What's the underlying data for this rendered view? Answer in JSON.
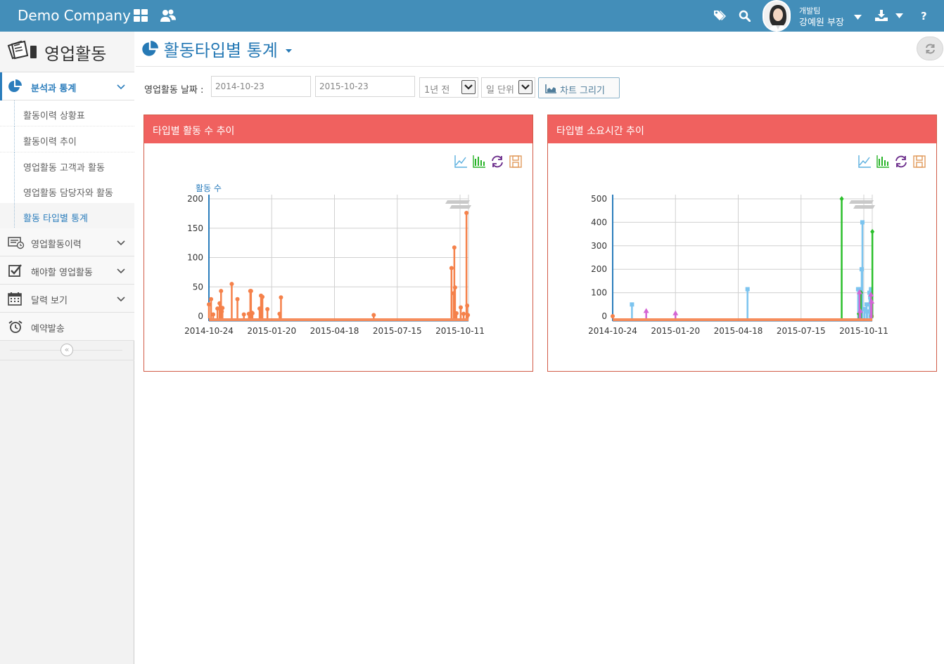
{
  "app": {
    "brand": "Demo Company",
    "user_dept": "개발팀",
    "user_name": "강예원 부장"
  },
  "sidebar": {
    "title": "영업활동",
    "menu": [
      {
        "label": "분석과 통계",
        "icon": "pie-chart-icon"
      },
      {
        "label": "영업활동이력",
        "icon": "history-list-icon"
      },
      {
        "label": "해야할 영업활동",
        "icon": "checkbox-icon"
      },
      {
        "label": "달력 보기",
        "icon": "calendar-icon"
      },
      {
        "label": "예약발송",
        "icon": "alarm-clock-icon"
      }
    ],
    "submenu": [
      {
        "label": "활동이력 상황표"
      },
      {
        "label": "활동이력 추이"
      },
      {
        "label": "영업활동 고객과 활동"
      },
      {
        "label": "영업활동 담당자와 활동"
      },
      {
        "label": "활동 타입별 통계"
      }
    ]
  },
  "page": {
    "title": "활동타입별 통계"
  },
  "filter": {
    "label": "영업활동 날짜 :",
    "start_date": "2014-10-23",
    "end_date": "2015-10-23",
    "period_selected": "1년 전",
    "unit_selected": "일 단위",
    "draw_button": "차트 그리기"
  },
  "colors": {
    "header": "#438eb9",
    "panel_header": "#f0615f",
    "accent": "#2679b5",
    "orange": "#f5814a",
    "blue": "#7cc4ef",
    "green": "#2bbf2b",
    "pink": "#d465d4"
  },
  "chart_data": [
    {
      "type": "line",
      "title": "타입별 활동 수 추이",
      "ylabel": "활동 수",
      "x_ticks": [
        "2014-10-24",
        "2015-01-20",
        "2015-04-18",
        "2015-07-15",
        "2015-10-11"
      ],
      "y_ticks": [
        0,
        50,
        100,
        150,
        200
      ],
      "ylim": [
        0,
        200
      ],
      "grid": true,
      "series": [
        {
          "color": "#f5814a",
          "x": [
            "2014-10-24",
            "2014-10-27",
            "2014-10-30",
            "2014-11-05",
            "2014-11-08",
            "2014-11-10",
            "2014-11-11",
            "2014-11-12",
            "2014-11-25",
            "2014-12-03",
            "2014-12-12",
            "2014-12-19",
            "2014-12-21",
            "2014-12-22",
            "2014-12-23",
            "2014-12-24",
            "2015-01-03",
            "2015-01-05",
            "2015-01-07",
            "2015-01-14",
            "2015-01-31",
            "2015-02-02",
            "2015-06-12",
            "2015-09-29",
            "2015-10-02",
            "2015-10-03",
            "2015-10-04",
            "2015-10-06",
            "2015-10-12",
            "2015-10-16",
            "2015-10-20",
            "2015-10-21",
            "2015-10-22"
          ],
          "y": [
            20,
            29,
            3,
            13,
            22,
            43,
            8,
            14,
            55,
            29,
            3,
            4,
            43,
            43,
            6,
            5,
            13,
            35,
            33,
            12,
            4,
            32,
            2,
            82,
            39,
            117,
            49,
            5,
            15,
            4,
            176,
            18,
            2
          ]
        }
      ]
    },
    {
      "type": "line",
      "title": "타입별 소요시간 추이",
      "x_ticks": [
        "2014-10-24",
        "2015-01-20",
        "2015-04-18",
        "2015-07-15",
        "2015-10-11"
      ],
      "y_ticks": [
        0,
        100,
        200,
        300,
        400,
        500
      ],
      "ylim": [
        0,
        500
      ],
      "grid": true,
      "series": [
        {
          "color": "#7cc4ef",
          "x": [
            "2014-11-20",
            "2015-05-01",
            "2015-10-03",
            "2015-10-05",
            "2015-10-08",
            "2015-10-09",
            "2015-10-12",
            "2015-10-15",
            "2015-10-16",
            "2015-10-19",
            "2015-10-20",
            "2015-10-21"
          ],
          "y": [
            50,
            115,
            115,
            115,
            200,
            400,
            30,
            50,
            20,
            100,
            80,
            115
          ]
        },
        {
          "color": "#f5814a",
          "x": [
            "2014-10-24",
            "2015-10-22"
          ],
          "y": [
            0,
            0
          ]
        },
        {
          "color": "#2bbf2b",
          "x": [
            "2015-09-10",
            "2015-10-04",
            "2015-10-07",
            "2015-10-23"
          ],
          "y": [
            500,
            10,
            100,
            360
          ]
        },
        {
          "color": "#d465d4",
          "x": [
            "2014-12-10",
            "2015-01-20",
            "2015-10-05",
            "2015-10-06",
            "2015-10-21",
            "2015-10-22"
          ],
          "y": [
            20,
            10,
            100,
            20,
            90,
            60
          ]
        }
      ]
    }
  ]
}
